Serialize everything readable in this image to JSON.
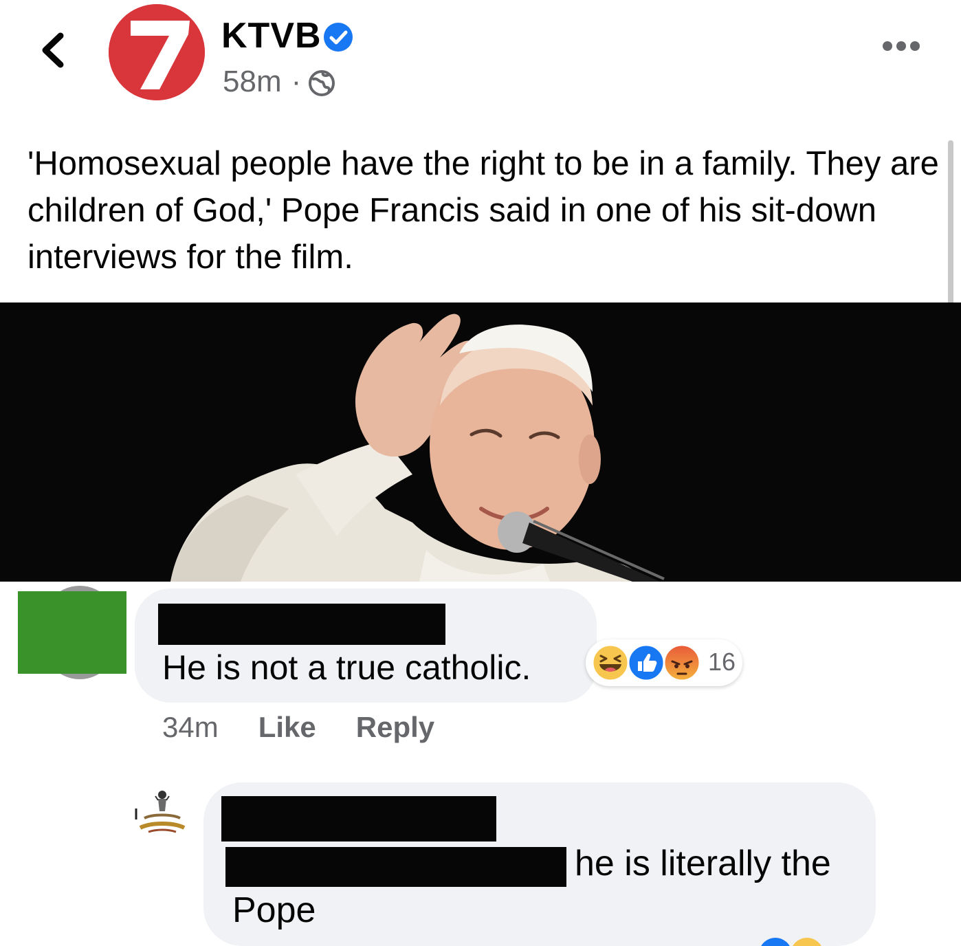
{
  "header": {
    "page_name": "KTVB",
    "logo_text": "7",
    "time": "58m",
    "separator": "·",
    "audience_icon": "globe-icon",
    "verified_icon": "verified-badge-icon",
    "more_icon": "more-options-icon",
    "back_icon": "chevron-left-icon"
  },
  "post": {
    "text": "'Homosexual people have the right to be in a family. They are children of God,' Pope Francis said in one of his sit-down interviews for the film."
  },
  "comments": [
    {
      "text": "He is not a true catholic.",
      "time": "34m",
      "like_label": "Like",
      "reply_label": "Reply",
      "reaction_count": "16",
      "reactions": [
        "haha-reaction-icon",
        "like-reaction-icon",
        "angry-reaction-icon"
      ]
    },
    {
      "text_line1": "he is literally the",
      "text_line2": "Pope"
    }
  ],
  "colors": {
    "brand_red": "#d9363c",
    "verified_blue": "#1877f2",
    "bubble": "#f0f2f5",
    "secondary_text": "#65676b",
    "censor_green": "#3a922a"
  }
}
